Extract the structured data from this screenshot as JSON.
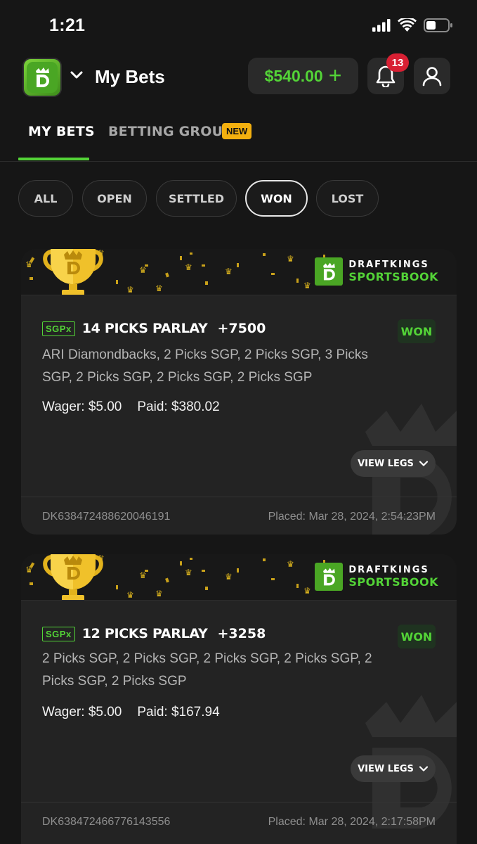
{
  "status_bar": {
    "time": "1:21"
  },
  "header": {
    "title": "My Bets",
    "balance": "$540.00",
    "balance_add": "+",
    "notification_count": "13"
  },
  "tabs": [
    {
      "label": "MY BETS",
      "active": true
    },
    {
      "label": "BETTING GROUPS",
      "badge": "NEW",
      "active": false
    }
  ],
  "filters": [
    {
      "label": "ALL",
      "active": false
    },
    {
      "label": "OPEN",
      "active": false
    },
    {
      "label": "SETTLED",
      "active": false
    },
    {
      "label": "WON",
      "active": true
    },
    {
      "label": "LOST",
      "active": false
    }
  ],
  "brand": {
    "line1": "DRAFTKINGS",
    "line2": "SPORTSBOOK",
    "accent": "#53d337",
    "gold": "#f3b00f"
  },
  "bets": [
    {
      "badge": "SGPx",
      "title": "14 PICKS PARLAY",
      "odds": "+7500",
      "status": "WON",
      "legs": "ARI Diamondbacks, 2 Picks SGP, 2 Picks SGP, 3 Picks SGP, 2 Picks SGP, 2 Picks SGP, 2 Picks SGP",
      "wager": "Wager: $5.00",
      "paid": "Paid: $380.02",
      "view_legs": "VIEW LEGS",
      "bet_id": "DK638472488620046191",
      "placed": "Placed: Mar 28, 2024, 2:54:23PM"
    },
    {
      "badge": "SGPx",
      "title": "12 PICKS PARLAY",
      "odds": "+3258",
      "status": "WON",
      "legs": "2 Picks SGP, 2 Picks SGP, 2 Picks SGP, 2 Picks SGP, 2 Picks SGP, 2 Picks SGP",
      "wager": "Wager: $5.00",
      "paid": "Paid: $167.94",
      "view_legs": "VIEW LEGS",
      "bet_id": "DK638472466776143556",
      "placed": "Placed: Mar 28, 2024, 2:17:58PM"
    }
  ]
}
